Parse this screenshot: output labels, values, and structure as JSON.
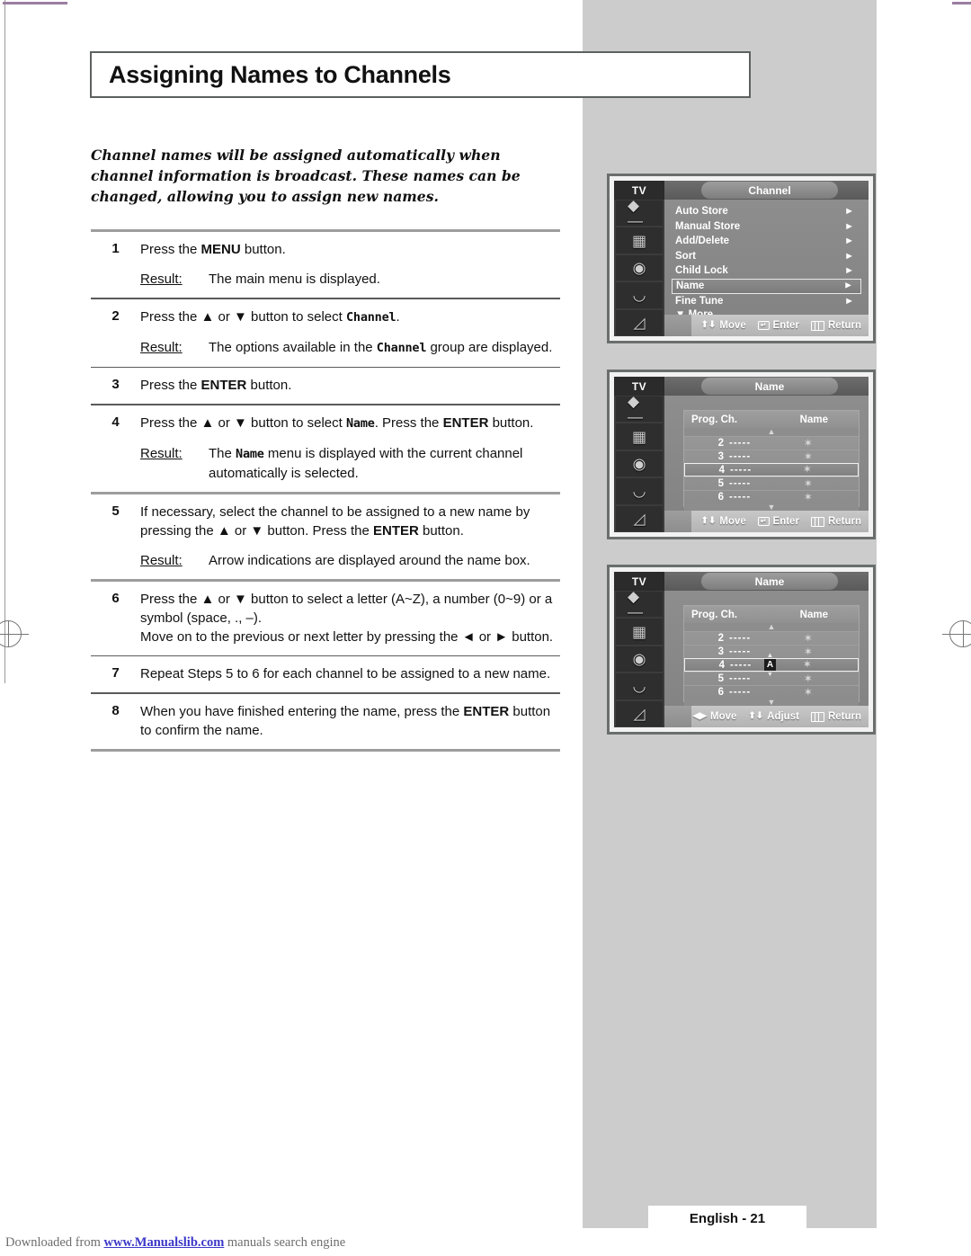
{
  "page": {
    "title": "Assigning Names to Channels",
    "intro": "Channel names will be assigned automatically when channel information is broadcast. These names can be changed, allowing you to assign new names.",
    "page_label": "English - 21",
    "download_prefix": "Downloaded from ",
    "download_link": "www.Manualslib.com",
    "download_suffix": " manuals search engine"
  },
  "steps": [
    {
      "num": "1",
      "lines": [
        "Press the MENU button."
      ],
      "instruction_pre": "Press the ",
      "instruction_bold": "MENU",
      "instruction_post": " button.",
      "result_label": "Result:",
      "result": "The main menu is displayed."
    },
    {
      "num": "2",
      "instruction_pre": "Press the ▲ or ▼ button to select ",
      "instruction_mono": "Channel",
      "instruction_post": ".",
      "result_label": "Result:",
      "result_pre": "The options available in the ",
      "result_mono": "Channel",
      "result_post": " group are displayed."
    },
    {
      "num": "3",
      "instruction_pre": "Press the ",
      "instruction_bold": "ENTER",
      "instruction_post": " button."
    },
    {
      "num": "4",
      "instruction_pre": "Press the ▲ or ▼ button to select ",
      "instruction_mono": "Name",
      "instruction_mid": ". Press the ",
      "instruction_bold": "ENTER",
      "instruction_post": " button.",
      "result_label": "Result:",
      "result_pre": "The ",
      "result_mono": "Name",
      "result_post": " menu is displayed with the current channel automatically is selected."
    },
    {
      "num": "5",
      "instruction_pre": "If necessary, select the channel to be assigned to a new name by pressing the ▲ or ▼ button. Press the ",
      "instruction_bold": "ENTER",
      "instruction_post": " button.",
      "result_label": "Result:",
      "result": "Arrow indications are displayed around the name box."
    },
    {
      "num": "6",
      "line1": "Press the ▲ or ▼ button to select a letter (A~Z), a number (0~9) or a symbol (space, ., –).",
      "line2": "Move on to the previous or next letter by pressing the ◄ or ► button."
    },
    {
      "num": "7",
      "instruction_full": "Repeat Steps 5 to 6 for each channel to be assigned to a new name."
    },
    {
      "num": "8",
      "instruction_pre": "When you have finished entering the name, press the ",
      "instruction_bold": "ENTER",
      "instruction_post": " button to confirm the name."
    }
  ],
  "osd": {
    "tv_label": "TV",
    "sidebar_icons": [
      "remote-icon",
      "tv-icon",
      "eye-icon",
      "sound-icon",
      "hand-icon"
    ],
    "screen1": {
      "title": "Channel",
      "items": [
        {
          "label": "Auto Store",
          "selected": false
        },
        {
          "label": "Manual Store",
          "selected": false
        },
        {
          "label": "Add/Delete",
          "selected": false
        },
        {
          "label": "Sort",
          "selected": false
        },
        {
          "label": "Child Lock",
          "selected": false
        },
        {
          "label": "Name",
          "selected": true
        },
        {
          "label": "Fine Tune",
          "selected": false
        }
      ],
      "more_label": "More",
      "footer": [
        {
          "icon": "updown-arrow-icon",
          "label": "Move"
        },
        {
          "icon": "enter-icon",
          "label": "Enter"
        },
        {
          "icon": "return-icon",
          "label": "Return"
        }
      ]
    },
    "screen2": {
      "title": "Name",
      "col_prog": "Prog. Ch.",
      "col_name": "Name",
      "rows": [
        {
          "prog": "2",
          "ch": "-----",
          "name": "✶",
          "selected": false,
          "edit": null
        },
        {
          "prog": "3",
          "ch": "-----",
          "name": "✶",
          "selected": false,
          "edit": null
        },
        {
          "prog": "4",
          "ch": "-----",
          "name": "✶",
          "selected": true,
          "edit": null
        },
        {
          "prog": "5",
          "ch": "-----",
          "name": "✶",
          "selected": false,
          "edit": null
        },
        {
          "prog": "6",
          "ch": "-----",
          "name": "✶",
          "selected": false,
          "edit": null
        }
      ],
      "footer": [
        {
          "icon": "updown-arrow-icon",
          "label": "Move"
        },
        {
          "icon": "enter-icon",
          "label": "Enter"
        },
        {
          "icon": "return-icon",
          "label": "Return"
        }
      ]
    },
    "screen3": {
      "title": "Name",
      "col_prog": "Prog. Ch.",
      "col_name": "Name",
      "rows": [
        {
          "prog": "2",
          "ch": "-----",
          "name": "✶",
          "selected": false,
          "edit": null
        },
        {
          "prog": "3",
          "ch": "-----",
          "name": "✶",
          "selected": false,
          "edit": null
        },
        {
          "prog": "4",
          "ch": "-----",
          "name": "✶",
          "selected": true,
          "edit": "A"
        },
        {
          "prog": "5",
          "ch": "-----",
          "name": "✶",
          "selected": false,
          "edit": null
        },
        {
          "prog": "6",
          "ch": "-----",
          "name": "✶",
          "selected": false,
          "edit": null
        }
      ],
      "footer": [
        {
          "icon": "leftright-arrow-icon",
          "label": "Move"
        },
        {
          "icon": "updown-arrow-icon",
          "label": "Adjust"
        },
        {
          "icon": "return-icon",
          "label": "Return"
        }
      ]
    }
  }
}
